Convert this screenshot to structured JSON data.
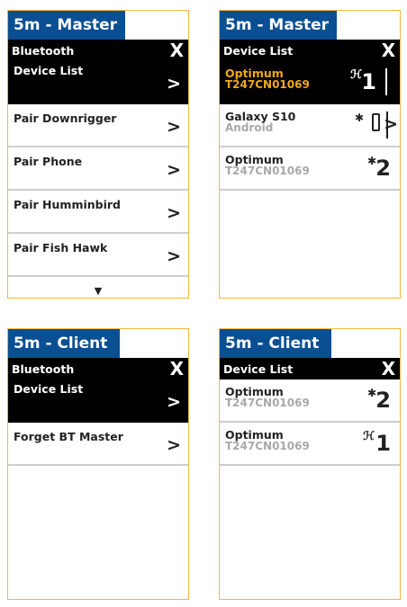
{
  "panels": [
    {
      "tag": "5m - Master",
      "title": "Bluetooth",
      "close": "X",
      "items": [
        {
          "label": "Device List",
          "chevron": ">"
        },
        {
          "label": "Pair Downrigger",
          "chevron": ">"
        },
        {
          "label": "Pair Phone",
          "chevron": ">"
        },
        {
          "label": "Pair Humminbird",
          "chevron": ">"
        },
        {
          "label": "Pair Fish Hawk",
          "chevron": ">"
        }
      ],
      "scroll_arrow": "▼"
    },
    {
      "tag": "5m - Master",
      "title": "Device List",
      "close": "X",
      "devices": [
        {
          "name": "Optimum",
          "sub": "T247CN01069",
          "icon": "humminbird-icon",
          "icon_glyph": "ℋ",
          "number": "1"
        },
        {
          "name": "Galaxy S10",
          "sub": "Android",
          "icon": "bluetooth-icon",
          "icon_glyph": "✱",
          "chevron": ">"
        },
        {
          "name": "Optimum",
          "sub": "T247CN01069",
          "icon": "bluetooth-icon",
          "icon_glyph": "✱",
          "number": "2"
        }
      ]
    },
    {
      "tag": "5m - Client",
      "title": "Bluetooth",
      "close": "X",
      "items": [
        {
          "label": "Device List",
          "chevron": ">"
        },
        {
          "label": "Forget BT Master",
          "chevron": ">"
        }
      ]
    },
    {
      "tag": "5m - Client",
      "title": "Device List",
      "close": "X",
      "devices": [
        {
          "name": "Optimum",
          "sub": "T247CN01069",
          "icon": "bluetooth-icon",
          "icon_glyph": "✱",
          "number": "2"
        },
        {
          "name": "Optimum",
          "sub": "T247CN01069",
          "icon": "humminbird-icon",
          "icon_glyph": "ℋ",
          "number": "1"
        }
      ]
    }
  ],
  "colors": {
    "tag_bg": "#0b4f93",
    "frame": "#f2b640",
    "selected_text": "#f0a81f",
    "header_bg": "#000000"
  }
}
